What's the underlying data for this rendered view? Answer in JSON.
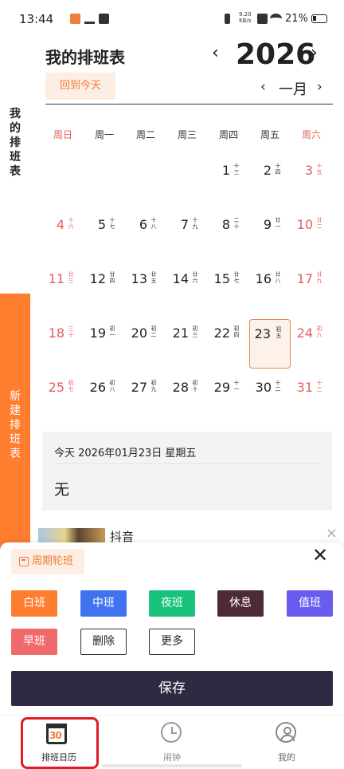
{
  "status_bar": {
    "time": "13:44",
    "network_speed_value": "9.20",
    "network_speed_unit": "KB/s",
    "battery": "21%"
  },
  "sidebar": {
    "my_schedule_label": "我的排班表",
    "new_schedule_label": "新建排班表"
  },
  "header": {
    "title": "我的排班表",
    "year": "2026",
    "back_to_today": "回到今天",
    "month": "一月",
    "prev_symbol": "‹",
    "next_symbol": "›"
  },
  "calendar": {
    "weekdays": [
      "周日",
      "周一",
      "周二",
      "周三",
      "周四",
      "周五",
      "周六"
    ],
    "days": [
      {
        "num": "1",
        "lunar": "十三"
      },
      {
        "num": "2",
        "lunar": "十四"
      },
      {
        "num": "3",
        "lunar": "十五"
      },
      {
        "num": "4",
        "lunar": "十六"
      },
      {
        "num": "5",
        "lunar": "十七"
      },
      {
        "num": "6",
        "lunar": "十八"
      },
      {
        "num": "7",
        "lunar": "十九"
      },
      {
        "num": "8",
        "lunar": "二十"
      },
      {
        "num": "9",
        "lunar": "廿一"
      },
      {
        "num": "10",
        "lunar": "廿二"
      },
      {
        "num": "11",
        "lunar": "廿三"
      },
      {
        "num": "12",
        "lunar": "廿四"
      },
      {
        "num": "13",
        "lunar": "廿五"
      },
      {
        "num": "14",
        "lunar": "廿六"
      },
      {
        "num": "15",
        "lunar": "廿七"
      },
      {
        "num": "16",
        "lunar": "廿八"
      },
      {
        "num": "17",
        "lunar": "廿九"
      },
      {
        "num": "18",
        "lunar": "三十"
      },
      {
        "num": "19",
        "lunar": "初一"
      },
      {
        "num": "20",
        "lunar": "初二"
      },
      {
        "num": "21",
        "lunar": "初三"
      },
      {
        "num": "22",
        "lunar": "初四"
      },
      {
        "num": "23",
        "lunar": "初五"
      },
      {
        "num": "24",
        "lunar": "初六"
      },
      {
        "num": "25",
        "lunar": "初七"
      },
      {
        "num": "26",
        "lunar": "初八"
      },
      {
        "num": "27",
        "lunar": "初九"
      },
      {
        "num": "28",
        "lunar": "初十"
      },
      {
        "num": "29",
        "lunar": "十一"
      },
      {
        "num": "30",
        "lunar": "十二"
      },
      {
        "num": "31",
        "lunar": "十三"
      }
    ],
    "first_weekday_index": 4,
    "today": "23"
  },
  "today_info": {
    "date_text": "今天 2026年01月23日 星期五",
    "shift": "无"
  },
  "ad": {
    "text": "抖音",
    "close": "×"
  },
  "sheet": {
    "cycle_label": "周期轮班",
    "close": "✕",
    "shifts": [
      {
        "label": "白班",
        "color": "#ff7d2f"
      },
      {
        "label": "中班",
        "color": "#3f73f0"
      },
      {
        "label": "夜班",
        "color": "#19c27a"
      },
      {
        "label": "休息",
        "color": "#4e2a36"
      },
      {
        "label": "值班",
        "color": "#6b5cf0"
      },
      {
        "label": "早班",
        "color": "#f06a6d"
      }
    ],
    "delete_label": "删除",
    "more_label": "更多",
    "save_label": "保存"
  },
  "bottom_nav": {
    "items": [
      {
        "label": "排班日历",
        "icon": "calendar-icon",
        "active": true
      },
      {
        "label": "闹钟",
        "icon": "alarm-clock-icon",
        "active": false
      },
      {
        "label": "我的",
        "icon": "person-icon",
        "active": false
      }
    ],
    "calendar_icon_text": "30"
  }
}
